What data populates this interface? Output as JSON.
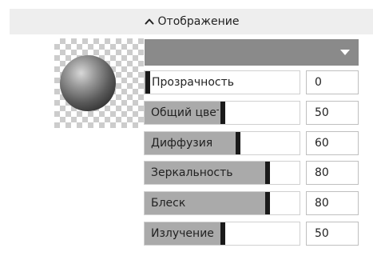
{
  "section": {
    "title": "Отображение",
    "expanded": true,
    "chevron_icon": "chevron-up-icon"
  },
  "material_preview": {
    "icon": "sphere-preview"
  },
  "material_select": {
    "selected": "",
    "caret_icon": "caret-down-icon",
    "color": "#8a8a8a"
  },
  "properties": [
    {
      "label": "Прозрачность",
      "value": "0",
      "level": 0
    },
    {
      "label": "Общий цвет",
      "value": "50",
      "level": 0.5
    },
    {
      "label": "Диффузия",
      "value": "60",
      "level": 0.6
    },
    {
      "label": "Зеркальность",
      "value": "80",
      "level": 0.8
    },
    {
      "label": "Блеск",
      "value": "80",
      "level": 0.8
    },
    {
      "label": "Излучение",
      "value": "50",
      "level": 0.5
    }
  ],
  "colors": {
    "slider_fill": "#aaaaaa",
    "slider_thumb": "#1a1a1a",
    "header_bg": "#eeeeee"
  }
}
